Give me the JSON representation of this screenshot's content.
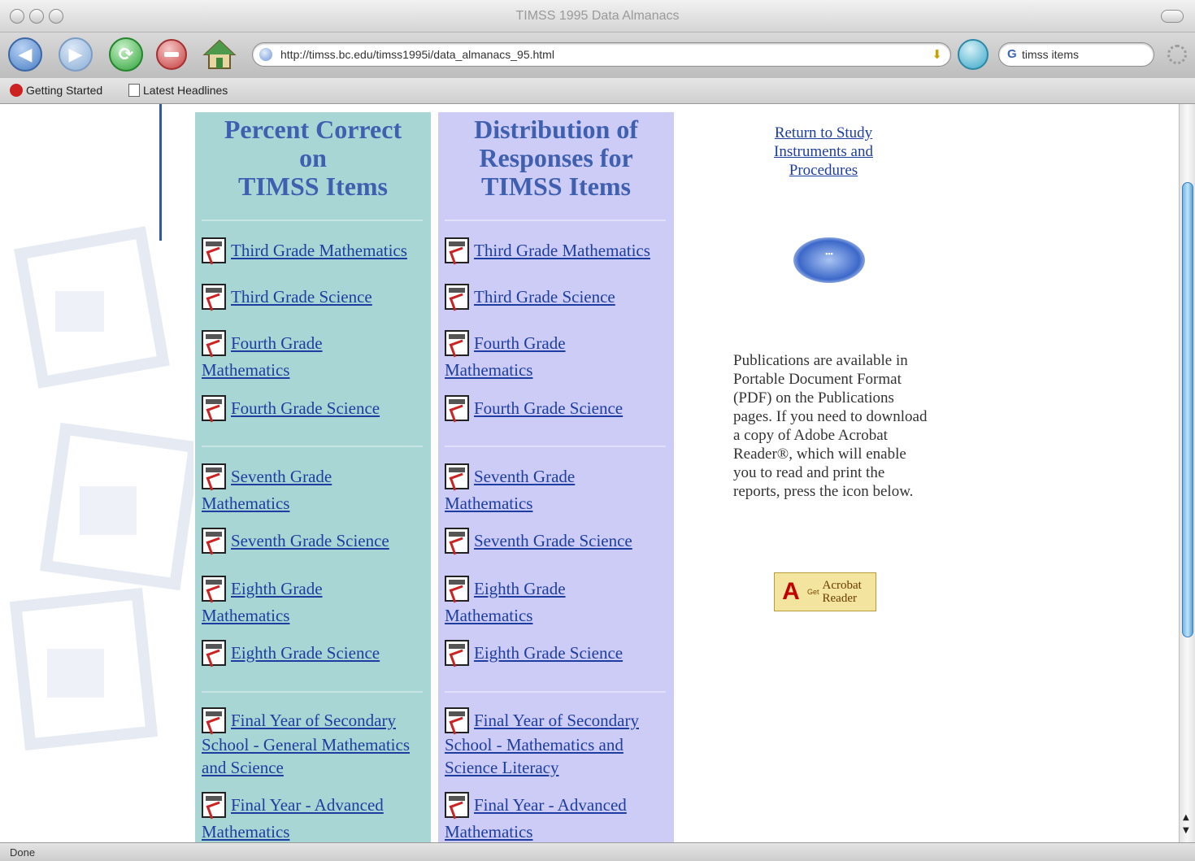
{
  "window": {
    "title": "TIMSS 1995 Data Almanacs"
  },
  "toolbar": {
    "back_icon": "back-arrow-icon",
    "forward_icon": "forward-arrow-icon",
    "reload_icon": "reload-icon",
    "stop_icon": "stop-icon",
    "home_icon": "home-icon",
    "url": "http://timss.bc.edu/timss1995i/data_almanacs_95.html",
    "search_value": "timss items"
  },
  "bookmarks": [
    {
      "label": "Getting Started"
    },
    {
      "label": "Latest Headlines"
    }
  ],
  "columns": {
    "percent": {
      "heading": [
        "Percent Correct",
        "on",
        "TIMSS Items"
      ],
      "items": [
        "Third Grade Mathematics",
        "Third Grade Science",
        "Fourth Grade Mathematics",
        "Fourth Grade Science",
        "Seventh Grade Mathematics",
        "Seventh Grade Science",
        "Eighth Grade Mathematics",
        "Eighth Grade Science",
        "Final Year of Secondary School - General Mathematics and Science",
        "Final Year - Advanced Mathematics"
      ]
    },
    "distribution": {
      "heading": [
        "Distribution of",
        "Responses for",
        "TIMSS Items"
      ],
      "items": [
        "Third Grade Mathematics",
        "Third Grade Science",
        "Fourth Grade Mathematics",
        "Fourth Grade Science",
        "Seventh Grade Mathematics",
        "Seventh Grade Science",
        "Eighth Grade Mathematics",
        "Eighth Grade Science",
        "Final Year of Secondary School - Mathematics and Science Literacy",
        "Final Year - Advanced Mathematics"
      ]
    }
  },
  "sidebar": {
    "return_link": "Return to Study Instruments and Procedures",
    "publications_text": "Publications are available in Portable Document Format (PDF) on the Publications pages. If you need to download a copy of Adobe Acrobat Reader®, which will enable you to read and print the reports, press the icon below.",
    "acrobat_badge": {
      "get": "Get",
      "name_line1": "Acrobat",
      "name_line2": "Reader"
    }
  },
  "status": {
    "text": "Done"
  },
  "colors": {
    "col_percent_bg": "#a8d6d4",
    "col_distribution_bg": "#ccccf6",
    "heading": "#3f5fb0",
    "link": "#1d3ea0"
  }
}
